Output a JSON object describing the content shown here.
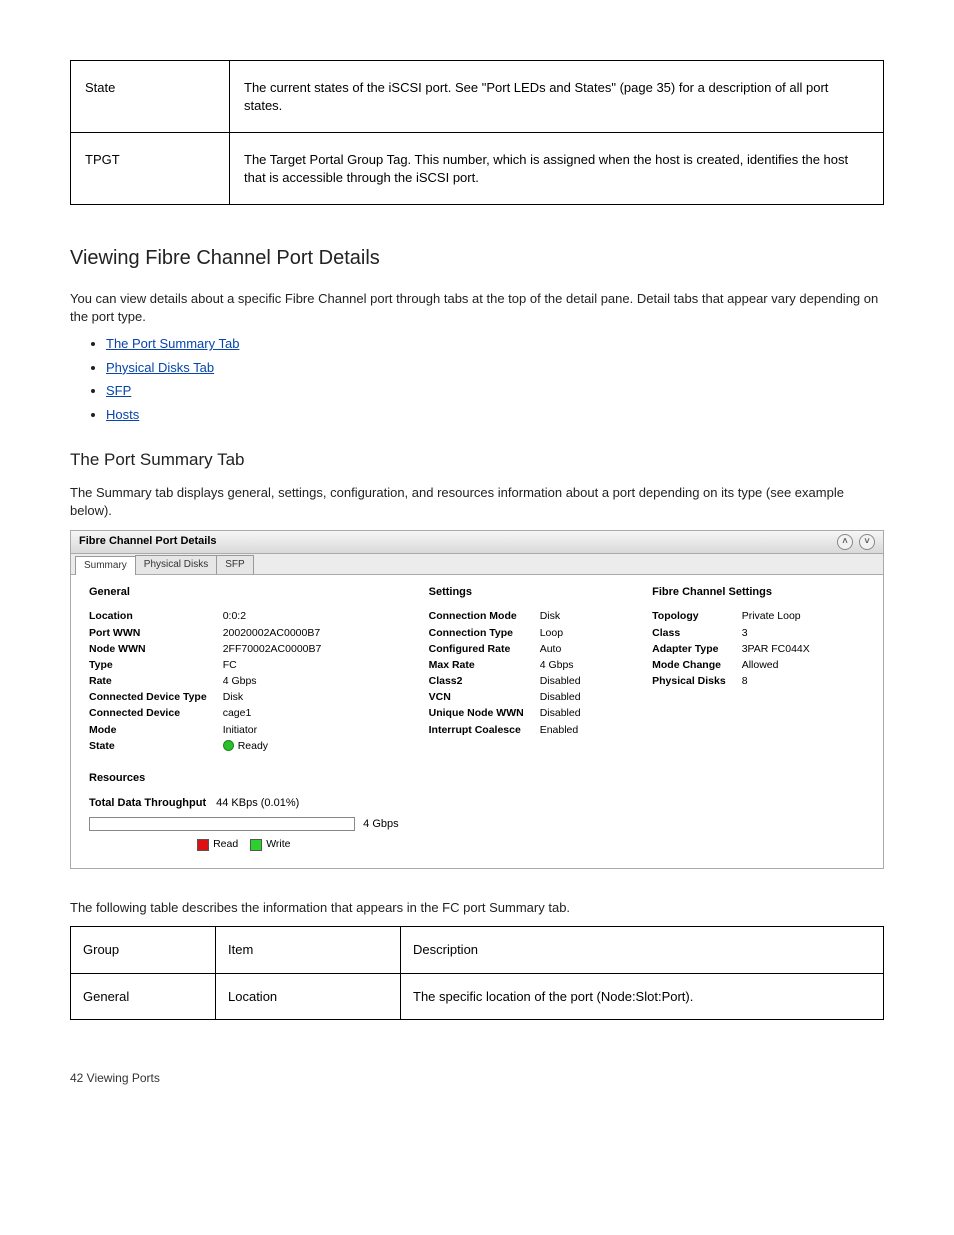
{
  "toc_rows": [
    {
      "c1": "State",
      "c2": "The current states of the iSCSI port. See \"Port LEDs and States\" (page 35) for a description of all port states."
    },
    {
      "c1": "TPGT",
      "c2": "The Target Portal Group Tag. This number, which is assigned when the host is created, identifies the host that is accessible through the iSCSI port."
    }
  ],
  "h2": "Viewing Fibre Channel Port Details",
  "para1": "You can view details about a specific Fibre Channel port through tabs at the top of the detail pane. Detail tabs that appear vary depending on the port type.",
  "bullets": [
    {
      "label": "The Port Summary Tab",
      "href": "#"
    },
    {
      "label": "Physical Disks Tab",
      "href": "#"
    },
    {
      "label": "SFP",
      "href": "#"
    },
    {
      "label": "Hosts",
      "href": "#"
    }
  ],
  "h3": "The Port Summary Tab",
  "para2": "The Summary tab displays general, settings, configuration, and resources information about a port depending on its type (see example below).",
  "shot": {
    "title": "Fibre Channel Port Details",
    "tabs": [
      "Summary",
      "Physical Disks",
      "SFP"
    ],
    "active_tab": 0,
    "general_head": "General",
    "settings_head": "Settings",
    "fc_head": "Fibre Channel Settings",
    "general": [
      {
        "k": "Location",
        "v": "0:0:2"
      },
      {
        "k": "Port WWN",
        "v": "20020002AC0000B7"
      },
      {
        "k": "Node WWN",
        "v": "2FF70002AC0000B7"
      },
      {
        "k": "Type",
        "v": "FC"
      },
      {
        "k": "Rate",
        "v": "4 Gbps"
      },
      {
        "k": "Connected Device Type",
        "v": "Disk"
      },
      {
        "k": "Connected Device",
        "v": "cage1"
      },
      {
        "k": "Mode",
        "v": "Initiator"
      },
      {
        "k": "State",
        "v": "Ready",
        "state": true
      }
    ],
    "settings": [
      {
        "k": "Connection Mode",
        "v": "Disk"
      },
      {
        "k": "Connection Type",
        "v": "Loop"
      },
      {
        "k": "Configured Rate",
        "v": "Auto"
      },
      {
        "k": "Max Rate",
        "v": "4 Gbps"
      },
      {
        "k": "Class2",
        "v": "Disabled"
      },
      {
        "k": "VCN",
        "v": "Disabled"
      },
      {
        "k": "Unique Node WWN",
        "v": "Disabled"
      },
      {
        "k": "Interrupt Coalesce",
        "v": "Enabled"
      }
    ],
    "fc": [
      {
        "k": "Topology",
        "v": "Private Loop"
      },
      {
        "k": "Class",
        "v": "3"
      },
      {
        "k": "Adapter Type",
        "v": "3PAR FC044X"
      },
      {
        "k": "Mode Change",
        "v": "Allowed"
      },
      {
        "k": "Physical Disks",
        "v": "8"
      }
    ],
    "resources_head": "Resources",
    "throughput_k": "Total Data Throughput",
    "throughput_v": "44 KBps (0.01%)",
    "progress_label": "4 Gbps",
    "legend_read": "Read",
    "legend_write": "Write"
  },
  "specs_caption": "The following table describes the information that appears in the FC port Summary tab.",
  "specs_head": [
    "Group",
    "Item",
    "Description"
  ],
  "specs_row": [
    "General",
    "Location",
    "The specific location of the port (Node:Slot:Port)."
  ],
  "footer_left": "42   Viewing Ports"
}
